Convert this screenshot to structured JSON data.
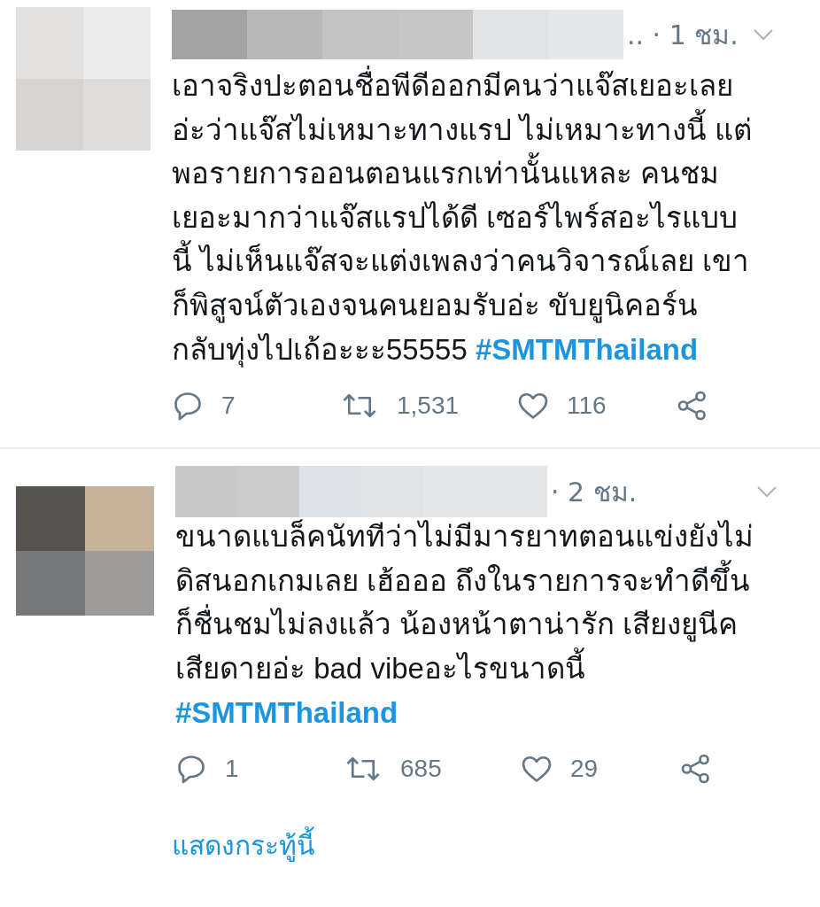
{
  "tweets": [
    {
      "time": ".. · 1 ชม.",
      "lines": [
        "เอาจริงปะตอนชื่อพีดีออกมีคนว่าแจ๊สเยอะเลย",
        "อ่ะว่าแจ๊สไม่เหมาะทางแรป ไม่เหมาะทางนี้ แต่",
        "พอรายการออนตอนแรกเท่านั้นแหละ คนชม",
        "เยอะมากว่าแจ๊สแรปได้ดี เซอร์ไพร์สอะไรแบบ",
        "นี้ ไม่เห็นแจ๊สจะแต่งเพลงว่าคนวิจารณ์เลย เขา",
        "ก็พิสูจน์ตัวเองจนคนยอมรับอ่ะ ขับยูนิคอร์น",
        "กลับทุ่งไปเถ้อะะะ55555"
      ],
      "hashtag": "#SMTMThailand",
      "hashtag_own_line": false,
      "replies": "7",
      "retweets": "1,531",
      "likes": "116"
    },
    {
      "time": "· 2 ชม.",
      "lines": [
        "ขนาดแบล็คนัททีว่าไม่มีมารยาทตอนแข่งยังไม่",
        "ดิสนอกเกมเลย เฮ้อออ ถึงในรายการจะทำดีขึ้น",
        "ก็ชื่นชมไม่ลงแล้ว น้องหน้าตาน่ารัก เสียงยูนีค",
        "เสียดายอ่ะ bad vibeอะไรขนาดนี้"
      ],
      "hashtag": "#SMTMThailand",
      "hashtag_own_line": true,
      "replies": "1",
      "retweets": "685",
      "likes": "29"
    }
  ],
  "show_thread_link": "แสดงกระทู้นี้"
}
